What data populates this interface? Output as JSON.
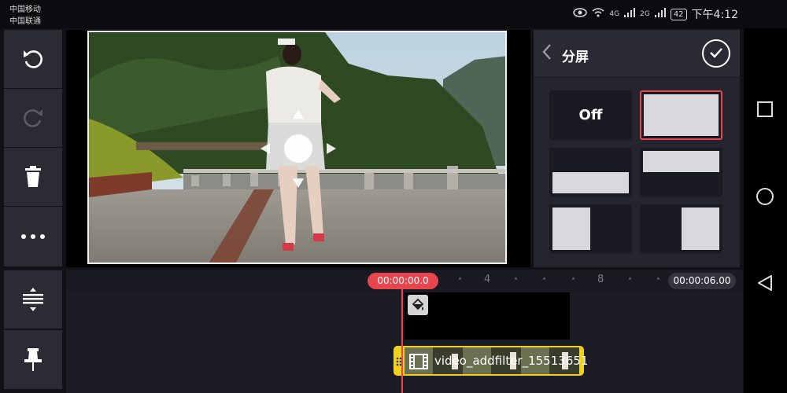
{
  "status_bar": {
    "carrier1": "中国移动",
    "carrier2": "中国联通",
    "net1": "4G",
    "net2": "2G",
    "battery": "42",
    "time": "下午4:12"
  },
  "panel": {
    "title": "分屏",
    "off_label": "Off"
  },
  "timeline": {
    "current_time": "00:00:00.0",
    "total_time": "00:00:06.00",
    "ruler_4": "4",
    "ruler_8": "8",
    "clip_name": "video_addfilter_15513651"
  },
  "colors": {
    "accent": "#e8464e",
    "clip_border": "#f0d020",
    "selected_tile": "#e8464e"
  }
}
